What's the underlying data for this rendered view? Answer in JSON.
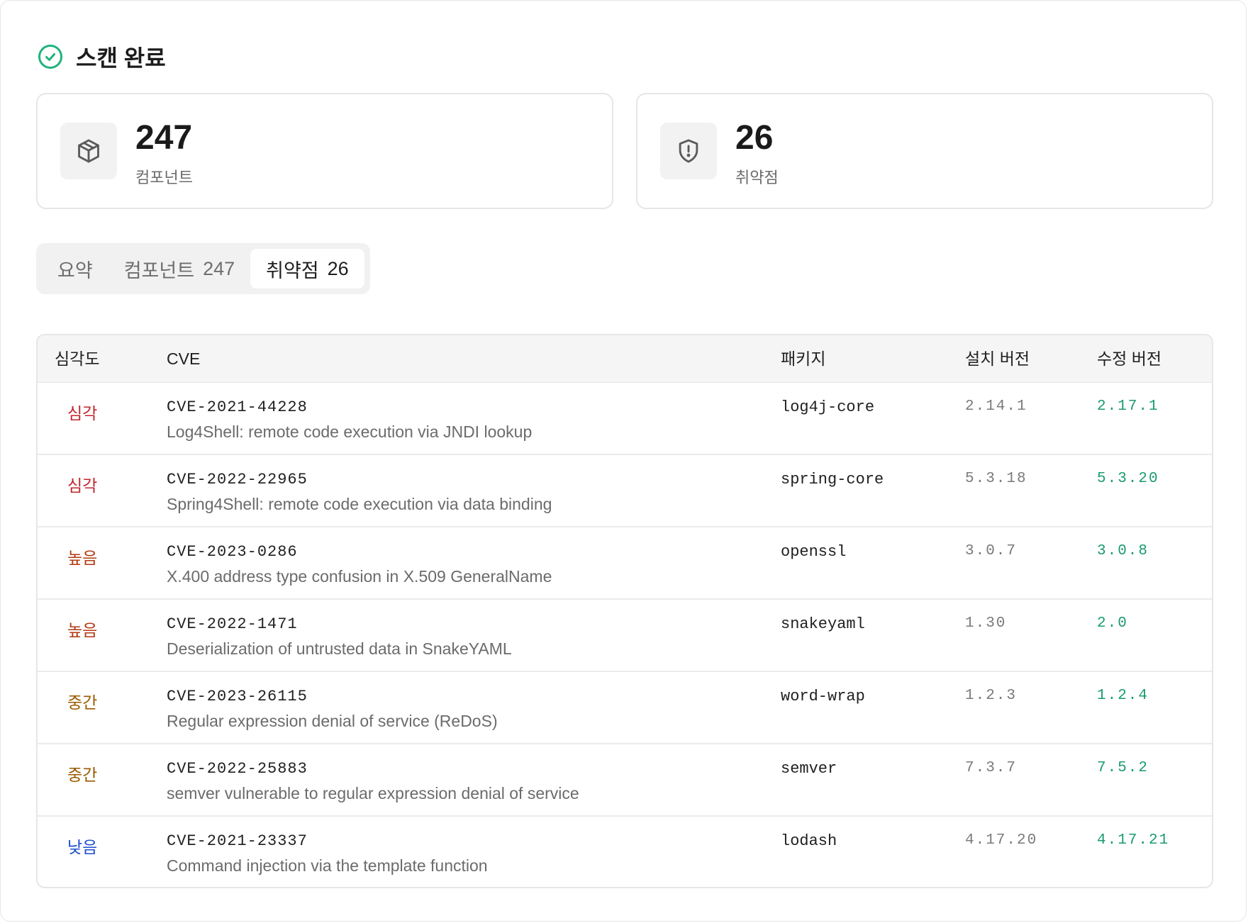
{
  "header": {
    "title": "스캔 완료",
    "icon": "check-circle-icon",
    "icon_color": "#1fb37c"
  },
  "stats": [
    {
      "value": "247",
      "label": "컴포넌트",
      "icon": "package-icon"
    },
    {
      "value": "26",
      "label": "취약점",
      "icon": "shield-alert-icon"
    }
  ],
  "tabs": [
    {
      "label": "요약",
      "count": ""
    },
    {
      "label": "컴포넌트",
      "count": "247"
    },
    {
      "label": "취약점",
      "count": "26",
      "active": true
    }
  ],
  "table": {
    "columns": [
      "심각도",
      "CVE",
      "패키지",
      "설치 버전",
      "수정 버전"
    ],
    "rows": [
      {
        "severity": "심각",
        "severity_color": "#c0262d",
        "cve": "CVE-2021-44228",
        "description": "Log4Shell: remote code execution via JNDI lookup",
        "package": "log4j-core",
        "installed": "2.14.1",
        "fixed": "2.17.1"
      },
      {
        "severity": "심각",
        "severity_color": "#c0262d",
        "cve": "CVE-2022-22965",
        "description": "Spring4Shell: remote code execution via data binding",
        "package": "spring-core",
        "installed": "5.3.18",
        "fixed": "5.3.20"
      },
      {
        "severity": "높음",
        "severity_color": "#b23a12",
        "cve": "CVE-2023-0286",
        "description": "X.400 address type confusion in X.509 GeneralName",
        "package": "openssl",
        "installed": "3.0.7",
        "fixed": "3.0.8"
      },
      {
        "severity": "높음",
        "severity_color": "#b23a12",
        "cve": "CVE-2022-1471",
        "description": "Deserialization of untrusted data in SnakeYAML",
        "package": "snakeyaml",
        "installed": "1.30",
        "fixed": "2.0"
      },
      {
        "severity": "중간",
        "severity_color": "#9a5a00",
        "cve": "CVE-2023-26115",
        "description": "Regular expression denial of service (ReDoS)",
        "package": "word-wrap",
        "installed": "1.2.3",
        "fixed": "1.2.4"
      },
      {
        "severity": "중간",
        "severity_color": "#9a5a00",
        "cve": "CVE-2022-25883",
        "description": "semver vulnerable to regular expression denial of service",
        "package": "semver",
        "installed": "7.3.7",
        "fixed": "7.5.2"
      },
      {
        "severity": "낮음",
        "severity_color": "#1f4fcf",
        "cve": "CVE-2021-23337",
        "description": "Command injection via the template function",
        "package": "lodash",
        "installed": "4.17.20",
        "fixed": "4.17.21"
      }
    ]
  }
}
